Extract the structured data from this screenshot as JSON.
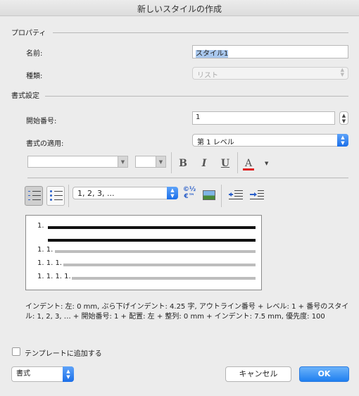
{
  "window": {
    "title": "新しいスタイルの作成"
  },
  "properties": {
    "heading": "プロパティ",
    "name_label": "名前:",
    "name_value": "スタイル1",
    "kind_label": "種類:",
    "kind_value": "リスト"
  },
  "format": {
    "heading": "書式設定",
    "start_label": "開始番号:",
    "start_value": "1",
    "apply_label": "書式の適用:",
    "apply_value": "第 1 レベル",
    "font_name_value": "",
    "font_size_value": "",
    "bold_label": "B",
    "italic_label": "I",
    "underline_label": "U",
    "font_color_label": "A",
    "font_color": "#e02020",
    "number_style_value": "1, 2, 3, ...",
    "symbol_button_label_top": "©½",
    "symbol_button_label_bottom": "€™"
  },
  "preview": {
    "lines": [
      {
        "num": "1."
      },
      {
        "num": ""
      },
      {
        "num": "1. 1."
      },
      {
        "num": "1. 1. 1."
      },
      {
        "num": "1. 1. 1. 1."
      }
    ]
  },
  "description": "インデント: 左:  0 mm, ぶら下げインデント: 4.25 字, アウトライン番号 + レベル: 1 + 番号のスタイル: 1, 2, 3, … + 開始番号: 1 + 配置: 左 + 整列:  0 mm + インデント:  7.5 mm, 優先度: 100",
  "footer": {
    "template_checkbox_label": "テンプレートに追加する",
    "template_checked": false,
    "format_menu_label": "書式",
    "cancel_label": "キャンセル",
    "ok_label": "OK"
  },
  "colors": {
    "accent": "#1f7ff0",
    "selection": "#a9c8ee"
  }
}
